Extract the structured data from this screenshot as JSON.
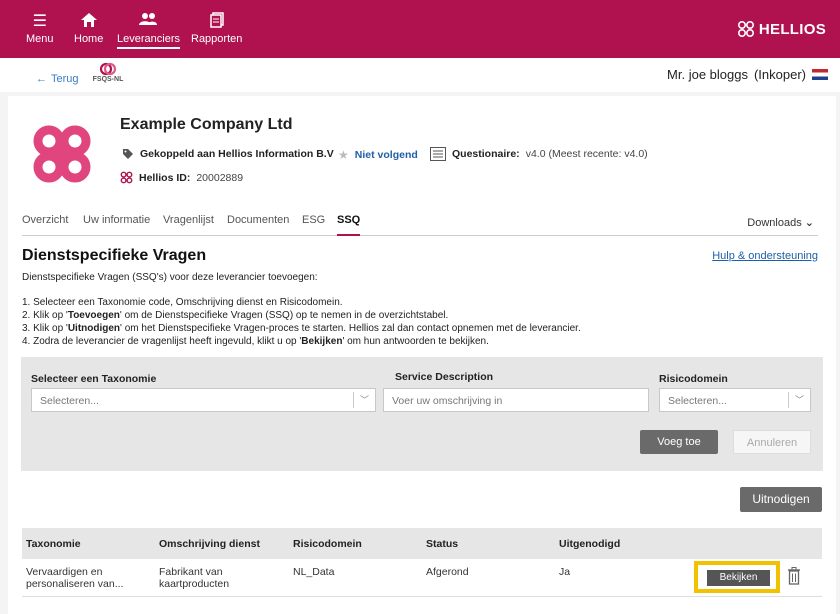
{
  "nav": {
    "menu": "Menu",
    "home": "Home",
    "suppliers": "Leveranciers",
    "reports": "Rapporten",
    "brand": "HELLIOS"
  },
  "subheader": {
    "back": "Terug",
    "fsqs": "FSQS-NL",
    "user": "Mr. joe bloggs",
    "role": "(Inkoper)"
  },
  "company": {
    "name": "Example Company Ltd",
    "linked": "Gekoppeld aan Hellios Information B.V",
    "follow": "Niet volgend",
    "questionnaire_label": "Questionaire:",
    "questionnaire_value": "v4.0 (Meest recente: v4.0)",
    "id_label": "Hellios ID:",
    "id_value": "20002889"
  },
  "tabs": [
    "Overzicht",
    "Uw informatie",
    "Vragenlijst",
    "Documenten",
    "ESG",
    "SSQ"
  ],
  "active_tab": "SSQ",
  "downloads": "Downloads",
  "section": {
    "title": "Dienstspecifieke Vragen",
    "help": "Hulp & ondersteuning",
    "intro": "Dienstspecifieke Vragen (SSQ's) voor deze leverancier toevoegen:",
    "step1": "1. Selecteer een Taxonomie code, Omschrijving dienst en Risicodomein.",
    "step2_a": "2. Klik op '",
    "step2_b": "Toevoegen",
    "step2_c": "' om de Dienstspecifieke Vragen (SSQ) op te nemen in de overzichtstabel.",
    "step3_a": "3. Klik op '",
    "step3_b": "Uitnodigen",
    "step3_c": "' om het Dienstspecifieke Vragen-proces te starten. Hellios zal dan contact opnemen met de leverancier.",
    "step4_a": "4. Zodra de leverancier de vragenlijst heeft ingevuld, klikt u op '",
    "step4_b": "Bekijken",
    "step4_c": "' om hun antwoorden te bekijken."
  },
  "form": {
    "taxonomy_label": "Selecteer een Taxonomie",
    "taxonomy_placeholder": "Selecteren...",
    "service_label": "Service Description",
    "service_placeholder": "Voer uw omschrijving in",
    "risk_label": "Risicodomein",
    "risk_placeholder": "Selecteren...",
    "add": "Voeg toe",
    "cancel": "Annuleren"
  },
  "invite_button": "Uitnodigen",
  "table": {
    "headers": [
      "Taxonomie",
      "Omschrijving dienst",
      "Risicodomein",
      "Status",
      "Uitgenodigd"
    ],
    "rows": [
      {
        "taxonomy": "Vervaardigen en personaliseren van...",
        "taxonomy_l1": "Vervaardigen en",
        "taxonomy_l2": "personaliseren van...",
        "service_l1": "Fabrikant van",
        "service_l2": "kaartproducten",
        "risk": "NL_Data",
        "status": "Afgerond",
        "invited": "Ja",
        "view": "Bekijken"
      }
    ]
  },
  "colors": {
    "brand": "#b0124f",
    "highlight": "#f2c200",
    "link": "#1d5fa8"
  }
}
